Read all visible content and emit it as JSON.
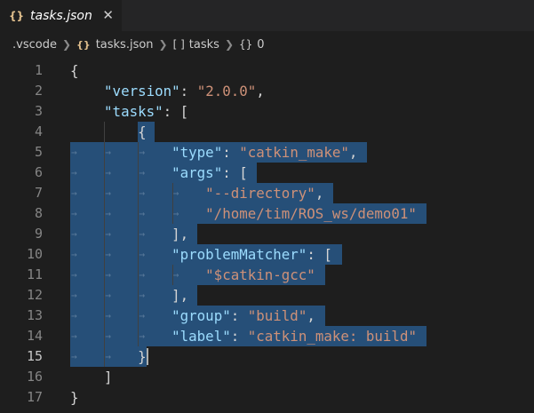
{
  "tab": {
    "icon": "{}",
    "title": "tasks.json",
    "close": "✕"
  },
  "breadcrumb": [
    {
      "icon": "",
      "label": ".vscode"
    },
    {
      "icon": "{}",
      "label": "tasks.json"
    },
    {
      "icon": "[ ]",
      "label": "tasks"
    },
    {
      "icon": "{}",
      "label": "0"
    }
  ],
  "active_line": 15,
  "lines": [
    {
      "n": "1",
      "text": "{"
    },
    {
      "n": "2",
      "text": "    \"version\": \"2.0.0\","
    },
    {
      "n": "3",
      "text": "    \"tasks\": ["
    },
    {
      "n": "4",
      "text": "        {"
    },
    {
      "n": "5",
      "text": "            \"type\": \"catkin_make\","
    },
    {
      "n": "6",
      "text": "            \"args\": ["
    },
    {
      "n": "7",
      "text": "                \"--directory\","
    },
    {
      "n": "8",
      "text": "                \"/home/tim/ROS_ws/demo01\""
    },
    {
      "n": "9",
      "text": "            ],"
    },
    {
      "n": "10",
      "text": "            \"problemMatcher\": ["
    },
    {
      "n": "11",
      "text": "                \"$catkin-gcc\""
    },
    {
      "n": "12",
      "text": "            ],"
    },
    {
      "n": "13",
      "text": "            \"group\": \"build\","
    },
    {
      "n": "14",
      "text": "            \"label\": \"catkin_make: build\""
    },
    {
      "n": "15",
      "text": "        }"
    },
    {
      "n": "16",
      "text": "    ]"
    },
    {
      "n": "17",
      "text": "}"
    }
  ]
}
